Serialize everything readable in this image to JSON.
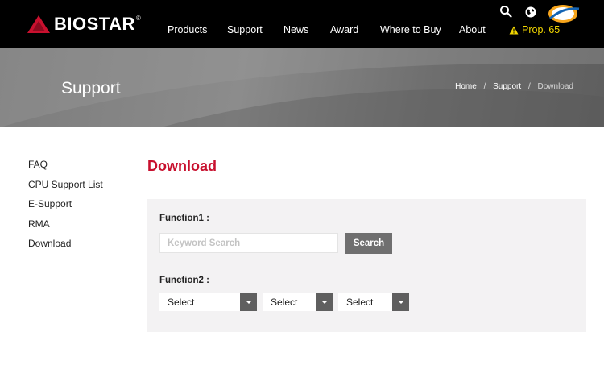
{
  "brand": {
    "name": "BIOSTAR",
    "reg": "®"
  },
  "nav": {
    "items": [
      "Products",
      "Support",
      "News",
      "Award",
      "Where to Buy",
      "About"
    ],
    "prop65": "Prop. 65"
  },
  "icons": {
    "search": "search-icon",
    "globe": "globe-icon",
    "newegg": "newegg-logo"
  },
  "hero": {
    "title": "Support"
  },
  "breadcrumb": {
    "home": "Home",
    "support": "Support",
    "current": "Download",
    "sep": "/"
  },
  "sidebar": {
    "items": [
      "FAQ",
      "CPU Support List",
      "E-Support",
      "RMA",
      "Download"
    ]
  },
  "main": {
    "title": "Download",
    "function1": {
      "label": "Function1 :",
      "placeholder": "Keyword Search",
      "button": "Search"
    },
    "function2": {
      "label": "Function2 :",
      "selects": [
        "Select",
        "Select",
        "Select"
      ]
    }
  },
  "colors": {
    "accent": "#c8102e",
    "prop65": "#f2d600",
    "button": "#6f6f6f"
  }
}
